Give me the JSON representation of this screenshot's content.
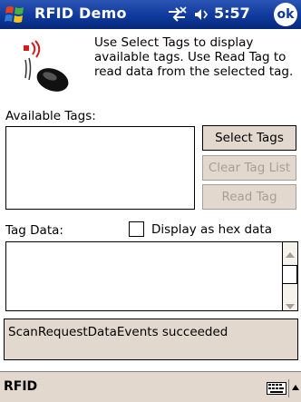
{
  "titlebar": {
    "app_title": "RFID Demo",
    "time": "5:57",
    "ok_label": "ok"
  },
  "intro": {
    "text": "Use Select Tags to display available tags.  Use Read Tag to read data from the selected tag."
  },
  "available_tags": {
    "label": "Available Tags:",
    "items": []
  },
  "buttons": {
    "select_tags": "Select Tags",
    "clear_tag_list": "Clear Tag List",
    "read_tag": "Read Tag"
  },
  "tag_data": {
    "label": "Tag Data:",
    "hex_checkbox_label": "Display as hex data",
    "hex_checked": false,
    "value": ""
  },
  "status": {
    "text": "ScanRequestDataEvents succeeded"
  },
  "menubar": {
    "left_menu": "RFID",
    "keyboard_icon": "keyboard-icon"
  },
  "colors": {
    "titlebar": "#0f3a9c",
    "button_face": "#e3d8cd",
    "disabled_text": "#a89e94"
  }
}
